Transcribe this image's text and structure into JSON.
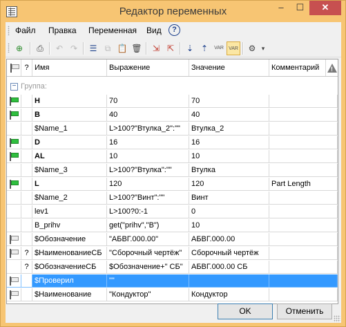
{
  "window": {
    "title": "Редактор переменных",
    "min": "–",
    "max": "☐",
    "close": "✕"
  },
  "menu": [
    "Файл",
    "Правка",
    "Переменная",
    "Вид"
  ],
  "help": "?",
  "columns": {
    "q": "?",
    "name": "Имя",
    "expr": "Выражение",
    "value": "Значение",
    "comment": "Комментарий"
  },
  "group": {
    "toggle": "−",
    "label": "Группа:"
  },
  "rows": [
    {
      "flag": "on",
      "q": "",
      "name": "H",
      "bold": true,
      "expr": "70",
      "value": "70",
      "comment": ""
    },
    {
      "flag": "on",
      "q": "",
      "name": "B",
      "bold": true,
      "expr": "40",
      "value": "40",
      "comment": ""
    },
    {
      "flag": "",
      "q": "",
      "name": "$Name_1",
      "bold": false,
      "expr": "L>100?\"Втулка_2\":\"\"",
      "value": "Втулка_2",
      "comment": ""
    },
    {
      "flag": "on",
      "q": "",
      "name": "D",
      "bold": true,
      "expr": "16",
      "value": "16",
      "comment": ""
    },
    {
      "flag": "on",
      "q": "",
      "name": "AL",
      "bold": true,
      "expr": "10",
      "value": "10",
      "comment": ""
    },
    {
      "flag": "",
      "q": "",
      "name": "$Name_3",
      "bold": false,
      "expr": "L>100?\"Втулка\":\"\"",
      "value": "Втулка",
      "comment": ""
    },
    {
      "flag": "on",
      "q": "",
      "name": "L",
      "bold": true,
      "expr": "120",
      "value": "120",
      "comment": "Part Length"
    },
    {
      "flag": "",
      "q": "",
      "name": "$Name_2",
      "bold": false,
      "expr": "L>100?\"Винт\":\"\"",
      "value": "Винт",
      "comment": ""
    },
    {
      "flag": "",
      "q": "",
      "name": "lev1",
      "bold": false,
      "expr": "L>100?0:-1",
      "value": "0",
      "comment": ""
    },
    {
      "flag": "",
      "q": "",
      "name": "B_prihv",
      "bold": false,
      "expr": "get(\"prihv\",\"B\")",
      "value": "10",
      "comment": ""
    },
    {
      "flag": "off",
      "q": "",
      "name": "$Обозначение",
      "bold": false,
      "expr": "\"АБВГ.000.00\"",
      "value": "АБВГ.000.00",
      "comment": ""
    },
    {
      "flag": "off",
      "q": "?",
      "name": "$НаименованиеСБ",
      "bold": false,
      "expr": "\"Сборочный чертёж\"",
      "value": "Сборочный чертёж",
      "comment": ""
    },
    {
      "flag": "",
      "q": "?",
      "name": "$ОбозначениеСБ",
      "bold": false,
      "expr": "$Обозначение+\" СБ\"",
      "value": "АБВГ.000.00 СБ",
      "comment": ""
    },
    {
      "flag": "off",
      "q": "",
      "name": "$Проверил",
      "bold": false,
      "expr": "\"\"",
      "value": "",
      "comment": "",
      "selected": true
    },
    {
      "flag": "off",
      "q": "",
      "name": "$Наименование",
      "bold": false,
      "expr": "\"Кондуктор\"",
      "value": "Кондуктор",
      "comment": ""
    }
  ],
  "buttons": {
    "ok": "OK",
    "cancel": "Отменить"
  },
  "toolbar": {
    "new_var": "⊕",
    "print": "⎙",
    "undo": "↶",
    "redo": "↷",
    "properties": "☰",
    "copy": "⧉",
    "paste": "📋",
    "delete": "🗑",
    "import": "⇲",
    "export": "⇱",
    "sort_down": "⇣",
    "sort_up": "⇡",
    "var1": "VAR",
    "var2": "VAR",
    "settings": "⚙",
    "more": "▾"
  }
}
